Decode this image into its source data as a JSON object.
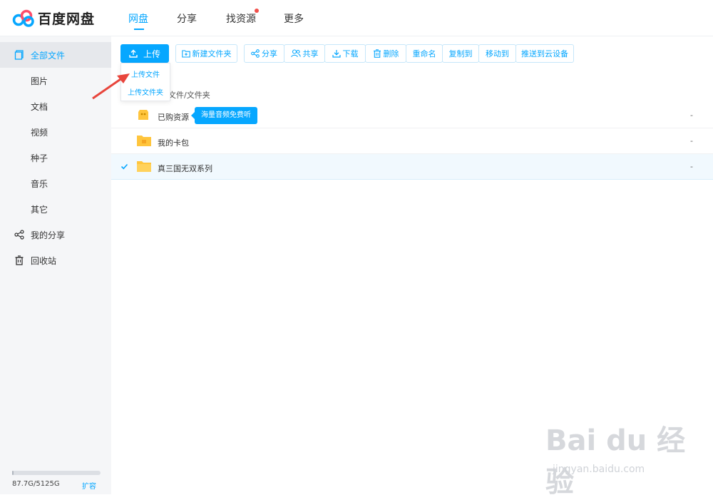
{
  "app": {
    "logo_text": "百度网盘"
  },
  "nav": {
    "items": [
      {
        "label": "网盘"
      },
      {
        "label": "分享"
      },
      {
        "label": "找资源"
      },
      {
        "label": "更多"
      }
    ]
  },
  "sidebar": {
    "items": [
      {
        "label": "全部文件"
      },
      {
        "label": "图片"
      },
      {
        "label": "文档"
      },
      {
        "label": "视频"
      },
      {
        "label": "种子"
      },
      {
        "label": "音乐"
      },
      {
        "label": "其它"
      },
      {
        "label": "我的分享"
      },
      {
        "label": "回收站"
      }
    ],
    "storage": {
      "text": "87.7G/5125G",
      "used_fraction": 0.017,
      "expand_label": "扩容"
    }
  },
  "toolbar": {
    "upload_label": "上传",
    "new_folder_label": "新建文件夹",
    "share_label": "分享",
    "cowork_label": "共享",
    "download_label": "下载",
    "delete_label": "删除",
    "rename_label": "重命名",
    "copy_to_label": "复制到",
    "move_to_label": "移动到",
    "push_label": "推送到云设备"
  },
  "upload_menu": {
    "items": [
      {
        "label": "上传文件"
      },
      {
        "label": "上传文件夹"
      }
    ]
  },
  "breadcrumb": {
    "text": "文件/文件夹"
  },
  "files": [
    {
      "name": "已购资源",
      "size": "-",
      "tooltip": "海量音频免费听"
    },
    {
      "name": "我的卡包",
      "size": "-"
    },
    {
      "name": "真三国无双系列",
      "size": "-",
      "checked": true
    }
  ],
  "watermark": {
    "main": "Bai du 经验",
    "sub": "jingyan.baidu.com"
  },
  "colors": {
    "accent": "#06a7ff",
    "folder": "#ffc53d",
    "arrow": "#e8453c"
  }
}
